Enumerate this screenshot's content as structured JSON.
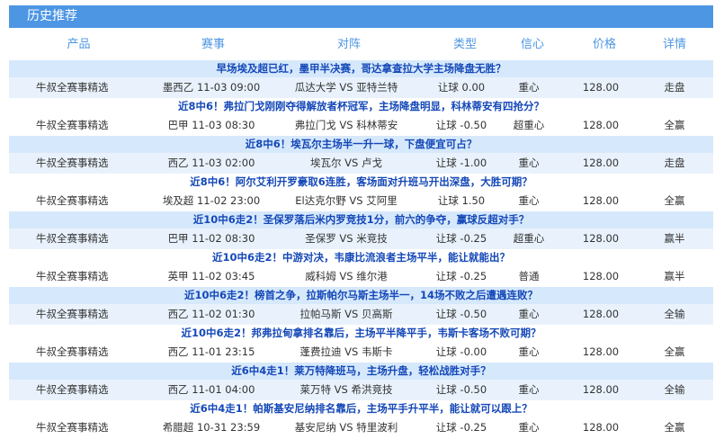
{
  "panel": {
    "title": "历史推荐"
  },
  "columns": {
    "product": "产品",
    "match": "赛事",
    "vs": "对阵",
    "type": "类型",
    "confidence": "信心",
    "price": "价格",
    "detail": "详情"
  },
  "rows": [
    {
      "headline": "早场埃及超已红，墨甲半决赛，哥达拿查拉大学主场降盘无胜？",
      "product": "牛叔全赛事精选",
      "match": "墨西乙 11-03 09:00",
      "vs": "瓜达大学 VS 亚特兰特",
      "type": "让球 0.00",
      "confidence": "重心",
      "price": "128.00",
      "result": "走盘"
    },
    {
      "headline": "近8中6！弗拉门戈刚刚夺得解放者杯冠军，主场降盘明显，科林蒂安有四抢分？",
      "product": "牛叔全赛事精选",
      "match": "巴甲 11-03 08:30",
      "vs": "弗拉门戈 VS 科林蒂安",
      "type": "让球 -0.50",
      "confidence": "超重心",
      "price": "128.00",
      "result": "全赢"
    },
    {
      "headline": "近8中6！埃瓦尔主场半一升一球，下盘便宜可占？",
      "product": "牛叔全赛事精选",
      "match": "西乙 11-03 02:00",
      "vs": "埃瓦尔 VS 卢戈",
      "type": "让球 -1.00",
      "confidence": "重心",
      "price": "128.00",
      "result": "走盘"
    },
    {
      "headline": "近8中6！阿尔艾利开罗豪取6连胜，客场面对升班马开出深盘，大胜可期？",
      "product": "牛叔全赛事精选",
      "match": "埃及超 11-02 23:00",
      "vs": "El达克尔野 VS 艾阿里",
      "type": "让球 1.50",
      "confidence": "重心",
      "price": "128.00",
      "result": "全赢"
    },
    {
      "headline": "近10中6走2！圣保罗落后米内罗竞技1分，前六的争夺，赢球反超对手？",
      "product": "牛叔全赛事精选",
      "match": "巴甲 11-02 08:30",
      "vs": "圣保罗 VS 米竞技",
      "type": "让球 -0.25",
      "confidence": "超重心",
      "price": "128.00",
      "result": "赢半"
    },
    {
      "headline": "近10中6走2！中游对决，韦康比流浪者主场平半，能让就能出？",
      "product": "牛叔全赛事精选",
      "match": "英甲 11-02 03:45",
      "vs": "威科姆 VS 维尔港",
      "type": "让球 -0.25",
      "confidence": "普通",
      "price": "128.00",
      "result": "赢半"
    },
    {
      "headline": "近10中6走2！榜首之争，拉斯帕尔马斯主场半一，14场不败之后遭遇连败？",
      "product": "牛叔全赛事精选",
      "match": "西乙 11-02 01:30",
      "vs": "拉帕马斯 VS 贝高斯",
      "type": "让球 -0.50",
      "confidence": "重心",
      "price": "128.00",
      "result": "全输"
    },
    {
      "headline": "近10中6走2！邦弗拉甸拿排名靠后，主场平半降平手，韦斯卡客场不败可期？",
      "product": "牛叔全赛事精选",
      "match": "西乙 11-01 23:15",
      "vs": "蓬费拉迪 VS 韦斯卡",
      "type": "让球 -0.00",
      "confidence": "重心",
      "price": "128.00",
      "result": "全赢"
    },
    {
      "headline": "近6中4走1！莱万特降班马，主场升盘，轻松战胜对手？",
      "product": "牛叔全赛事精选",
      "match": "西乙 11-01 04:00",
      "vs": "莱万特 VS 希洪竞技",
      "type": "让球 -0.50",
      "confidence": "重心",
      "price": "128.00",
      "result": "全输"
    },
    {
      "headline": "近6中4走1！帕斯基安尼纳排名靠后，主场平手升平半，能让就可以跟上？",
      "product": "牛叔全赛事精选",
      "match": "希腊超 10-31 23:59",
      "vs": "基安尼纳 VS 特里波利",
      "type": "让球 -0.25",
      "confidence": "重心",
      "price": "128.00",
      "result": "全赢"
    }
  ]
}
